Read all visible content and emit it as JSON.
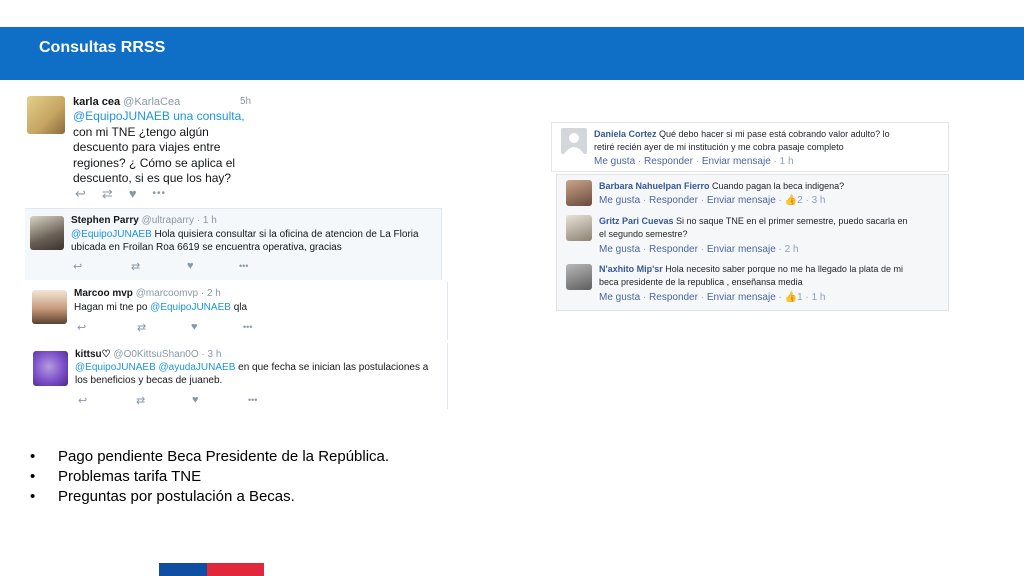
{
  "header": {
    "title": "Consultas RRSS"
  },
  "twitter": [
    {
      "name": "karla cea",
      "handle": "@KarlaCea",
      "time": "5h",
      "lines": [
        "@EquipoJUNAEB una consulta,",
        "con mi TNE ¿tengo algún",
        "descuento para viajes entre",
        "regiones? ¿ Cómo se aplica el",
        "descuento, si es que los hay?"
      ]
    },
    {
      "name": "Stephen Parry",
      "handle": "@ultraparry · 1 h",
      "mention": "@EquipoJUNAEB",
      "text1": " Hola quisiera consultar si la oficina de atencion de La Floria",
      "text2": "ubicada en Froilan Roa 6619 se encuentra operativa, gracias"
    },
    {
      "name": "Marcoo mvp",
      "handle": "@marcoomvp · 2 h",
      "text1": "Hagan mi tne po ",
      "mention": "@EquipoJUNAEB",
      "text2": "  qla"
    },
    {
      "name": "kittsu♡",
      "handle": "@O0KittsuShan0O · 3 h",
      "mention": "@EquipoJUNAEB @ayudaJUNAEB",
      "text1": "  en que fecha se inician las postulaciones a",
      "text2": "los beneficios y becas de juaneb."
    }
  ],
  "icons": {
    "reply": "↩",
    "retweet": "⇄",
    "like": "♥",
    "more": "•••"
  },
  "facebook": {
    "main": {
      "name": "Daniela Cortez",
      "text1": " Qué debo hacer si mi pase está cobrando valor adulto? lo",
      "text2": "retiré recién ayer de mi institución y me cobra pasaje completo",
      "like": "Me gusta",
      "reply": "Responder",
      "send": "Enviar mensaje",
      "time": "1 h"
    },
    "replies": [
      {
        "name": "Barbara Nahuelpan Fierro",
        "text1": " Cuando pagan la beca indigena?",
        "text2": "",
        "like": "Me gusta",
        "reply": "Responder",
        "send": "Enviar mensaje",
        "likes": "2",
        "time": "3 h"
      },
      {
        "name": "Gritz Pari Cuevas",
        "text1": " Si no saque TNE en el primer semestre, puedo sacarla en",
        "text2": "el segundo semestre?",
        "like": "Me gusta",
        "reply": "Responder",
        "send": "Enviar mensaje",
        "likes": "",
        "time": "2 h"
      },
      {
        "name": "N'axhito Mip'sr",
        "text1": " Hola necesito saber porque no me ha llegado la plata de mi",
        "text2": "beca presidente de la republica , enseñansa media",
        "like": "Me gusta",
        "reply": "Responder",
        "send": "Enviar mensaje",
        "likes": "1",
        "time": "1 h"
      }
    ]
  },
  "bullets": [
    "Pago pendiente Beca Presidente de la República.",
    "Problemas tarifa TNE",
    "Preguntas por postulación a Becas."
  ],
  "colors": {
    "header": "#0f6fc6",
    "footer_blue": "#0f4ea0",
    "footer_red": "#e0283a",
    "mention": "#1b95e0"
  }
}
